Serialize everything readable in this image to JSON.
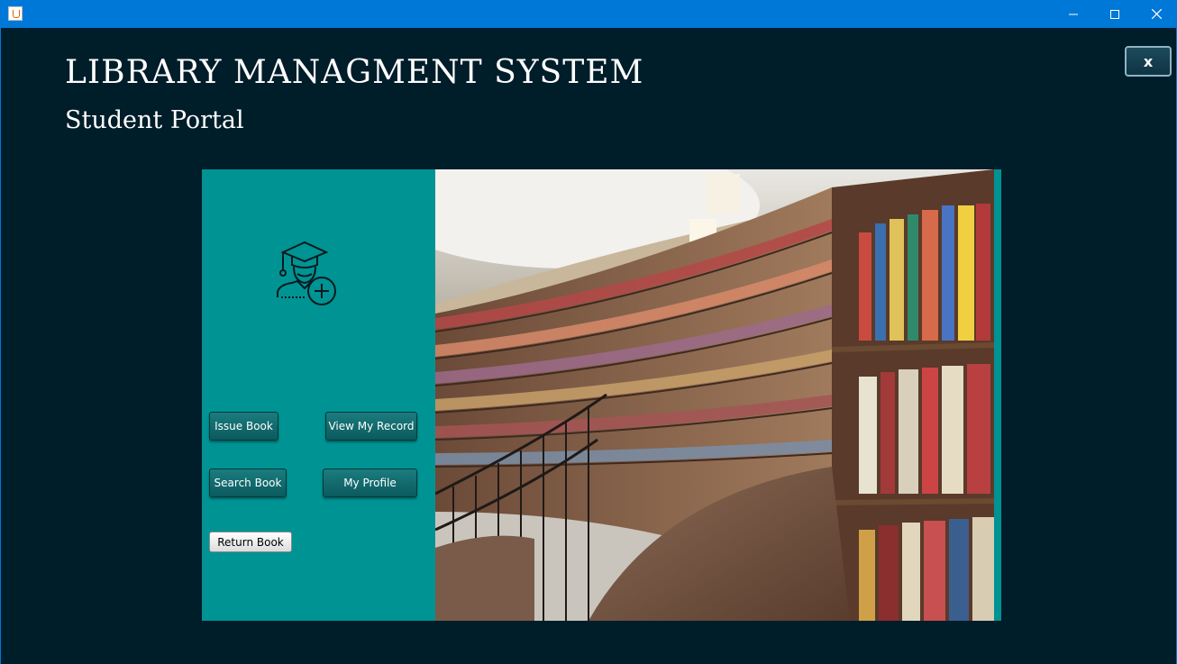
{
  "window": {
    "minimize_glyph": "—",
    "maximize_glyph": "☐",
    "close_glyph": "✕"
  },
  "app": {
    "title": "LIBRARY MANAGMENT SYSTEM",
    "subtitle": "Student Portal",
    "exit_label": "x"
  },
  "panel": {
    "avatar_icon": "student-add-icon",
    "buttons": {
      "issue": "Issue Book",
      "record": "View My Record",
      "search": "Search Book",
      "profile": "My Profile",
      "return": "Return Book"
    }
  },
  "colors": {
    "background": "#001d2a",
    "panel": "#009393",
    "button": "#0b5a5e",
    "titlebar": "#0078d7"
  }
}
